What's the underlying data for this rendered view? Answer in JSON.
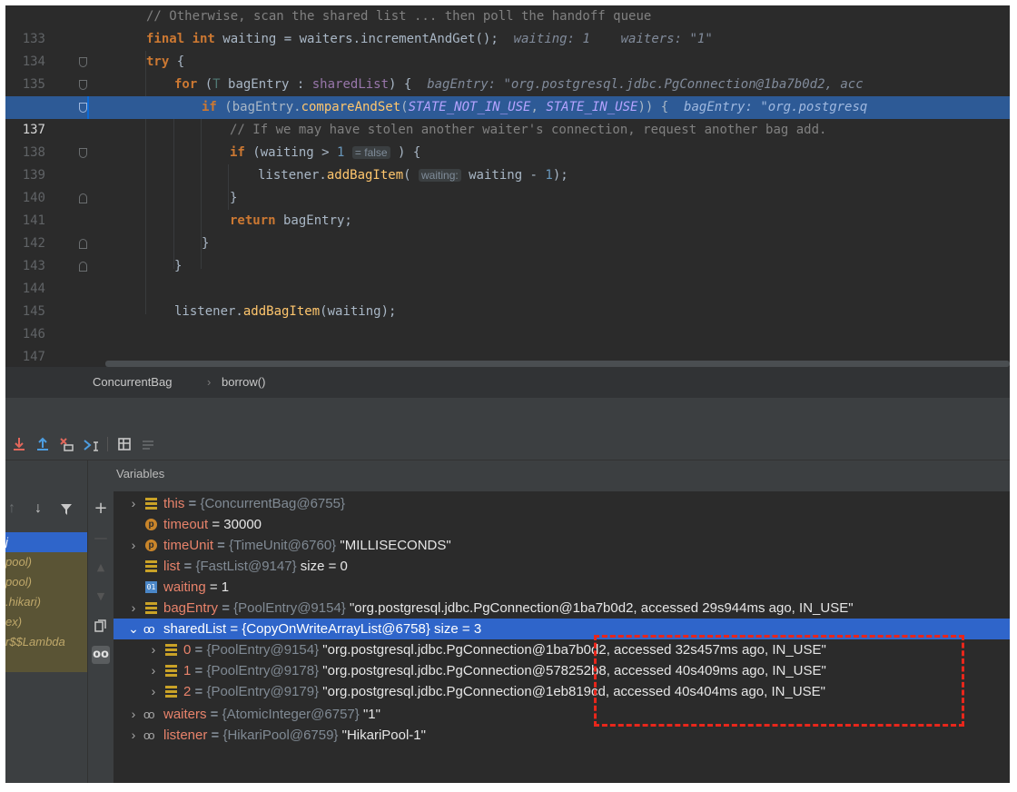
{
  "editor": {
    "lines": [
      {
        "num": "133",
        "text": "// Otherwise, scan the shared list ... then poll the handoff queue"
      },
      {
        "num": "134",
        "kw": "final int",
        "var": "waiting",
        "rest": " = waiters.incrementAndGet();",
        "hint": "waiting: 1    waiters: \"1\""
      },
      {
        "num": "135",
        "kw": "try",
        "rest": " {"
      },
      {
        "num": "136",
        "kw": "for",
        "pre": " (",
        "tparam": "T",
        "mid": " bagEntry : ",
        "field": "sharedList",
        "post": ") {",
        "hint": "bagEntry: \"org.postgresql.jdbc.PgConnection@1ba7b0d2, acc"
      },
      {
        "num": "137",
        "kw": "if",
        "pre": " (bagEntry.",
        "fn": "compareAndSet",
        "open": "(",
        "const1": "STATE_NOT_IN_USE",
        "comma": ", ",
        "const2": "STATE_IN_USE",
        "post": ")) {",
        "hint": "bagEntry: \"org.postgresq"
      },
      {
        "num": "138",
        "text": "// If we may have stolen another waiter's connection, request another bag add."
      },
      {
        "num": "139",
        "kw": "if",
        "pre": " (waiting > ",
        "num_lit": "1",
        "inline": "= false",
        "post": " ) {"
      },
      {
        "num": "140",
        "pre": "listener.",
        "fn": "addBagItem",
        "open": "( ",
        "inline": "waiting:",
        "post": " waiting - ",
        "num_lit": "1",
        "tail": ");"
      },
      {
        "num": "141",
        "text": "}"
      },
      {
        "num": "142",
        "kw": "return",
        "rest": " bagEntry;"
      },
      {
        "num": "143",
        "text": "}"
      },
      {
        "num": "144",
        "text": "}"
      },
      {
        "num": "145",
        "text": ""
      },
      {
        "num": "146",
        "pre": "listener.",
        "fn": "addBagItem",
        "post": "(waiting);"
      },
      {
        "num": "147",
        "text": ""
      }
    ]
  },
  "breadcrumb": {
    "class_name": "ConcurrentBag",
    "separator": "›",
    "method": "borrow()"
  },
  "toolbar": {
    "icons": [
      "step-into-icon",
      "step-out-icon",
      "drop-frame-icon",
      "run-to-cursor-icon",
      "evaluate-icon",
      "trace-icon"
    ]
  },
  "frames_panel": {
    "items": [
      {
        "label": "j"
      },
      {
        "label": "pool)"
      },
      {
        "label": "pool)"
      },
      {
        "label": ".hikari)"
      },
      {
        "label": "ex)"
      },
      {
        "label": "r$$Lambda"
      },
      {
        "label": ""
      }
    ]
  },
  "variables": {
    "title": "Variables",
    "rows": [
      {
        "name": "this",
        "type": "{ConcurrentBag@6755}",
        "value": ""
      },
      {
        "name": "timeout",
        "eq": "= 30000"
      },
      {
        "name": "timeUnit",
        "type": "{TimeUnit@6760}",
        "value": "\"MILLISECONDS\""
      },
      {
        "name": "list",
        "type": "{FastList@9147}",
        "value": " size = 0"
      },
      {
        "name": "waiting",
        "eq": "= 1"
      },
      {
        "name": "bagEntry",
        "type": "{PoolEntry@9154}",
        "value": "\"org.postgresql.jdbc.PgConnection@1ba7b0d2, accessed 29s944ms ago, IN_USE\""
      },
      {
        "name": "sharedList",
        "type": "{CopyOnWriteArrayList@6758}",
        "value": " size = 3"
      },
      {
        "name": "0",
        "type": "{PoolEntry@9154}",
        "value": "\"org.postgresql.jdbc.PgConnection@1ba7b0d2, accessed 32s457ms ago, IN_USE\""
      },
      {
        "name": "1",
        "type": "{PoolEntry@9178}",
        "value": "\"org.postgresql.jdbc.PgConnection@578252b8, accessed 40s409ms ago, IN_USE\""
      },
      {
        "name": "2",
        "type": "{PoolEntry@9179}",
        "value": "\"org.postgresql.jdbc.PgConnection@1eb819cd, accessed 40s404ms ago, IN_USE\""
      },
      {
        "name": "waiters",
        "type": "{AtomicInteger@6757}",
        "value": "\"1\""
      },
      {
        "name": "listener",
        "type": "{HikariPool@6759}",
        "value": "\"HikariPool-1\""
      }
    ]
  },
  "colors": {
    "selection": "#2f65ca",
    "editor_bg": "#2b2b2b",
    "highlight_line": "#2d5a96",
    "annotation": "#e8261b"
  }
}
